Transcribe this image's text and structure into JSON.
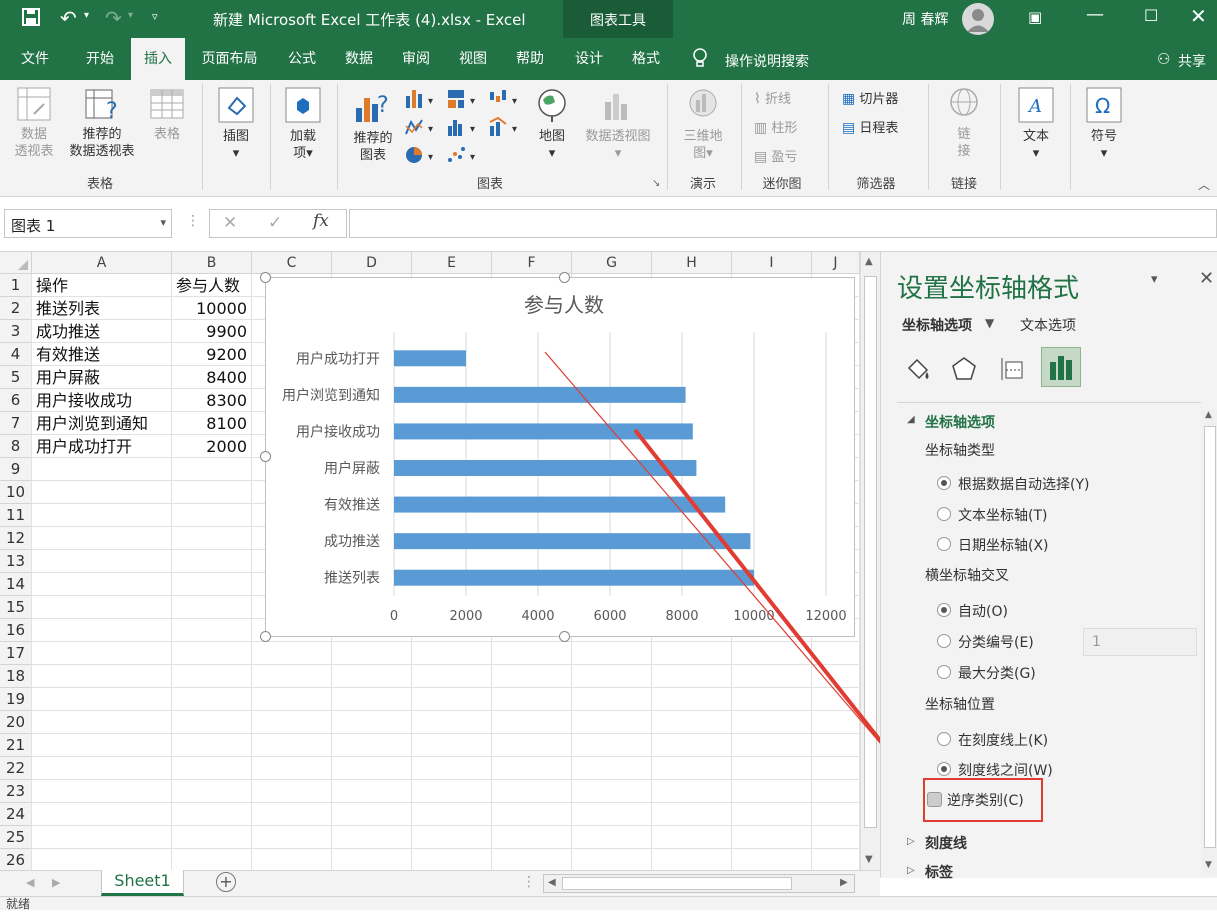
{
  "title_bar": {
    "file_title": "新建 Microsoft Excel 工作表 (4).xlsx  -  Excel",
    "context_tool": "图表工具",
    "user_name": "周 春辉"
  },
  "tabs": [
    {
      "label": "文件"
    },
    {
      "label": "开始"
    },
    {
      "label": "插入"
    },
    {
      "label": "页面布局"
    },
    {
      "label": "公式"
    },
    {
      "label": "数据"
    },
    {
      "label": "审阅"
    },
    {
      "label": "视图"
    },
    {
      "label": "帮助"
    },
    {
      "label": "设计"
    },
    {
      "label": "格式"
    }
  ],
  "tell_me": "操作说明搜索",
  "share": "共享",
  "ribbon": {
    "pivot_l1": "数据",
    "pivot_l2": "透视表",
    "rec_pivot_l1": "推荐的",
    "rec_pivot_l2": "数据透视表",
    "table": "表格",
    "group_tables": "表格",
    "illustrations": "插图",
    "addins_l1": "加载",
    "addins_l2": "项",
    "rec_charts_l1": "推荐的",
    "rec_charts_l2": "图表",
    "map": "地图",
    "pivot_chart": "数据透视图",
    "group_charts": "图表",
    "map3d_l1": "三维地",
    "map3d_l2": "图",
    "group_tours": "演示",
    "spark_line": "折线",
    "spark_col": "柱形",
    "spark_wl": "盈亏",
    "group_sparklines": "迷你图",
    "slicer": "切片器",
    "timeline": "日程表",
    "group_filters": "筛选器",
    "link_l1": "链",
    "link_l2": "接",
    "group_links": "链接",
    "text": "文本",
    "symbols": "符号"
  },
  "formula_bar": {
    "name_box": "图表 1",
    "fx": "fx",
    "cancel": "✕",
    "enter": "✓"
  },
  "sheet": {
    "columns": [
      "A",
      "B",
      "C",
      "D",
      "E",
      "F",
      "G",
      "H",
      "I",
      "J"
    ],
    "rows": [
      "1",
      "2",
      "3",
      "4",
      "5",
      "6",
      "7",
      "8",
      "9",
      "10",
      "11",
      "12",
      "13",
      "14",
      "15",
      "16",
      "17",
      "18",
      "19",
      "20",
      "21",
      "22",
      "23",
      "24",
      "25",
      "26"
    ],
    "cells": [
      [
        "操作",
        "参与人数"
      ],
      [
        "推送列表",
        "10000"
      ],
      [
        "成功推送",
        "9900"
      ],
      [
        "有效推送",
        "9200"
      ],
      [
        "用户屏蔽",
        "8400"
      ],
      [
        "用户接收成功",
        "8300"
      ],
      [
        "用户浏览到通知",
        "8100"
      ],
      [
        "用户成功打开",
        "2000"
      ]
    ],
    "tab_name": "Sheet1"
  },
  "chart_data": {
    "type": "bar",
    "orientation": "horizontal",
    "title": "参与人数",
    "categories": [
      "用户成功打开",
      "用户浏览到通知",
      "用户接收成功",
      "用户屏蔽",
      "有效推送",
      "成功推送",
      "推送列表"
    ],
    "values": [
      2000,
      8100,
      8300,
      8400,
      9200,
      9900,
      10000
    ],
    "xlim": [
      0,
      12000
    ],
    "xticks": [
      "0",
      "2000",
      "4000",
      "6000",
      "8000",
      "10000",
      "12000"
    ],
    "grid": true,
    "bar_color": "#5b9bd5"
  },
  "pane": {
    "title": "设置坐标轴格式",
    "tab_axis": "坐标轴选项",
    "tab_text": "文本选项",
    "section": "坐标轴选项",
    "axis_type_label": "坐标轴类型",
    "opt_auto": "根据数据自动选择(Y)",
    "opt_text": "文本坐标轴(T)",
    "opt_date": "日期坐标轴(X)",
    "cross_label": "横坐标轴交叉",
    "cross_auto": "自动(O)",
    "cross_cat": "分类编号(E)",
    "cross_cat_value": "1",
    "cross_max": "最大分类(G)",
    "pos_label": "坐标轴位置",
    "pos_on": "在刻度线上(K)",
    "pos_between": "刻度线之间(W)",
    "reverse": "逆序类别(C)",
    "tick_marks": "刻度线",
    "labels": "标签"
  },
  "status": "就绪",
  "annotation_color": "#e03c31",
  "accent": "#217346"
}
